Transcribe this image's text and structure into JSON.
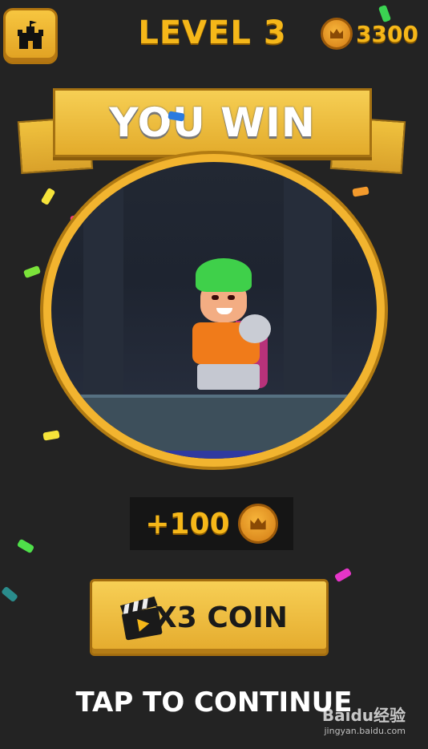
{
  "header": {
    "level_label": "LEVEL 3",
    "coins": "3300",
    "home_icon": "castle-icon",
    "coin_icon": "crown-coin-icon"
  },
  "banner": {
    "title": "YOU WIN"
  },
  "reward": {
    "amount": "+100",
    "coin_icon": "crown-coin-icon"
  },
  "multiplier_button": {
    "label": "X3 COIN",
    "icon": "video-clapper-icon"
  },
  "continue": {
    "label": "TAP TO CONTINUE"
  },
  "watermark": {
    "brand": "Baidu经验",
    "url": "jingyan.baidu.com"
  },
  "colors": {
    "background": "#232323",
    "accent_gold": "#f5b719",
    "button_gold": "#f2c14a",
    "hero_hair": "#3fd04a"
  }
}
